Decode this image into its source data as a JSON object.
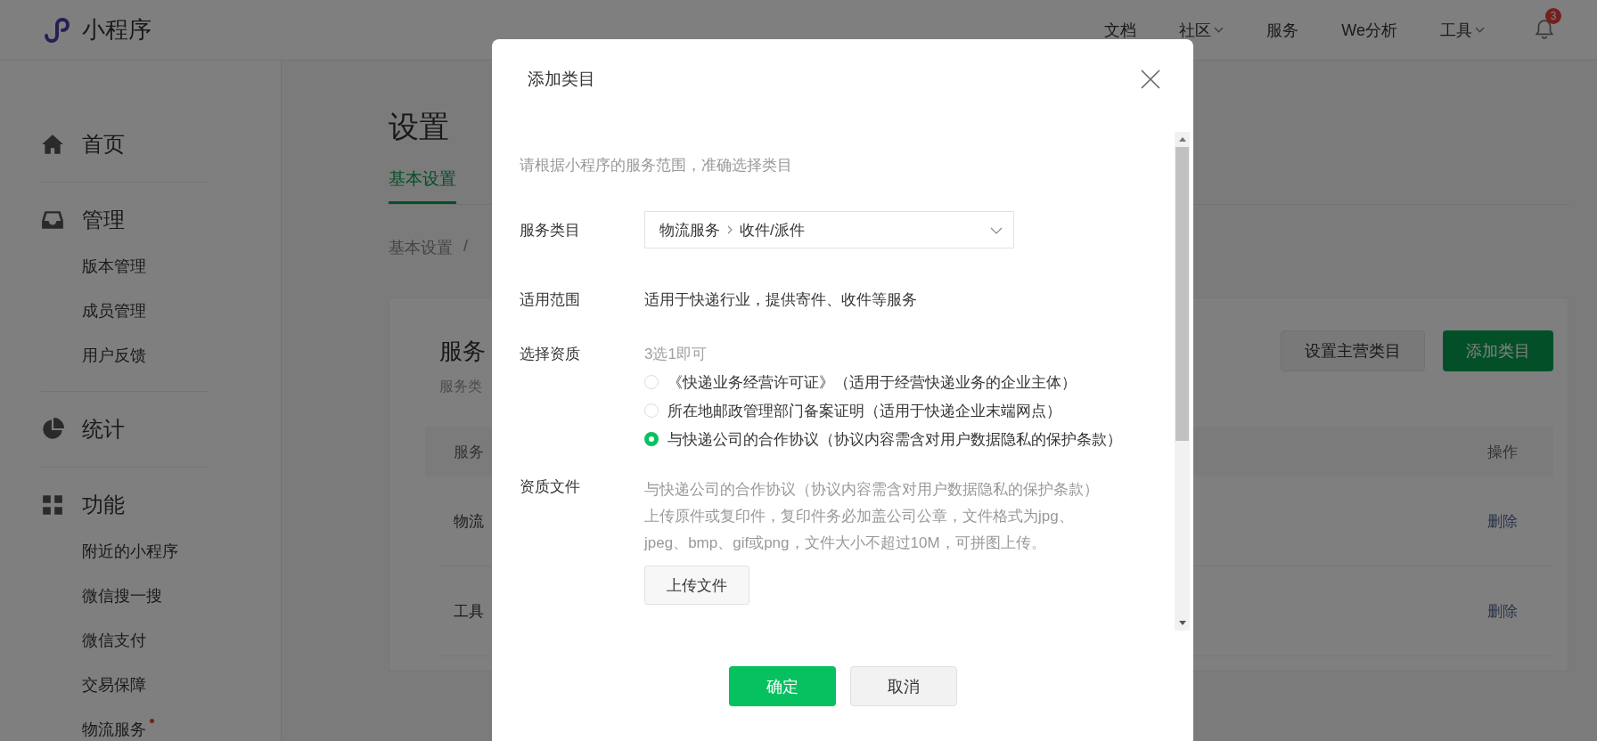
{
  "header": {
    "logo_text": "小程序",
    "nav": [
      {
        "label": "文档",
        "dropdown": false
      },
      {
        "label": "社区",
        "dropdown": true
      },
      {
        "label": "服务",
        "dropdown": false
      },
      {
        "label": "We分析",
        "dropdown": false
      },
      {
        "label": "工具",
        "dropdown": true
      }
    ],
    "notification_count": "3"
  },
  "sidebar": {
    "sections": [
      {
        "title": "首页"
      },
      {
        "title": "管理",
        "items": [
          {
            "label": "版本管理",
            "dot": false
          },
          {
            "label": "成员管理",
            "dot": false
          },
          {
            "label": "用户反馈",
            "dot": false
          }
        ]
      },
      {
        "title": "统计"
      },
      {
        "title": "功能",
        "items": [
          {
            "label": "附近的小程序",
            "dot": false
          },
          {
            "label": "微信搜一搜",
            "dot": false
          },
          {
            "label": "微信支付",
            "dot": false
          },
          {
            "label": "交易保障",
            "dot": false
          },
          {
            "label": "物流服务",
            "dot": true
          }
        ]
      }
    ]
  },
  "page": {
    "title": "设置",
    "tabs": [
      {
        "label": "基本设置",
        "selected": true
      }
    ],
    "breadcrumb": [
      "基本设置",
      "/"
    ],
    "section_title": "服务",
    "section_subtitle": "服务类",
    "buttons": [
      {
        "label": "设置主营类目",
        "kind": "default"
      },
      {
        "label": "添加类目",
        "kind": "primary"
      }
    ],
    "table": {
      "columns": [
        "服务",
        "操作"
      ],
      "rows": [
        {
          "column_1": "物流",
          "action": "删除"
        },
        {
          "column_1": "工具",
          "action": "删除"
        }
      ]
    }
  },
  "dialog": {
    "title": "添加类目",
    "hint": "请根据小程序的服务范围，准确选择类目",
    "fields": [
      {
        "kind": "select",
        "label": "服务类目",
        "path": [
          "物流服务",
          "收件/派件"
        ]
      },
      {
        "kind": "text",
        "label": "适用范围",
        "value": "适用于快递行业，提供寄件、收件等服务"
      },
      {
        "kind": "radio",
        "label": "选择资质",
        "hint": "3选1即可",
        "options": [
          {
            "label": "《快递业务经营许可证》（适用于经营快递业务的企业主体）",
            "selected": false
          },
          {
            "label": "所在地邮政管理部门备案证明（适用于快递企业末端网点）",
            "selected": false
          },
          {
            "label": "与快递公司的合作协议（协议内容需含对用户数据隐私的保护条款）",
            "selected": true
          }
        ]
      },
      {
        "kind": "upload",
        "label": "资质文件",
        "title": "与快递公司的合作协议（协议内容需含对用户数据隐私的保护条款）",
        "description": "上传原件或复印件，复印件务必加盖公司公章，文件格式为jpg、jpeg、bmp、gif或png，文件大小不超过10M，可拼图上传。",
        "button": "上传文件"
      }
    ],
    "buttons": [
      {
        "label": "确定",
        "kind": "primary"
      },
      {
        "label": "取消",
        "kind": "default"
      }
    ]
  }
}
